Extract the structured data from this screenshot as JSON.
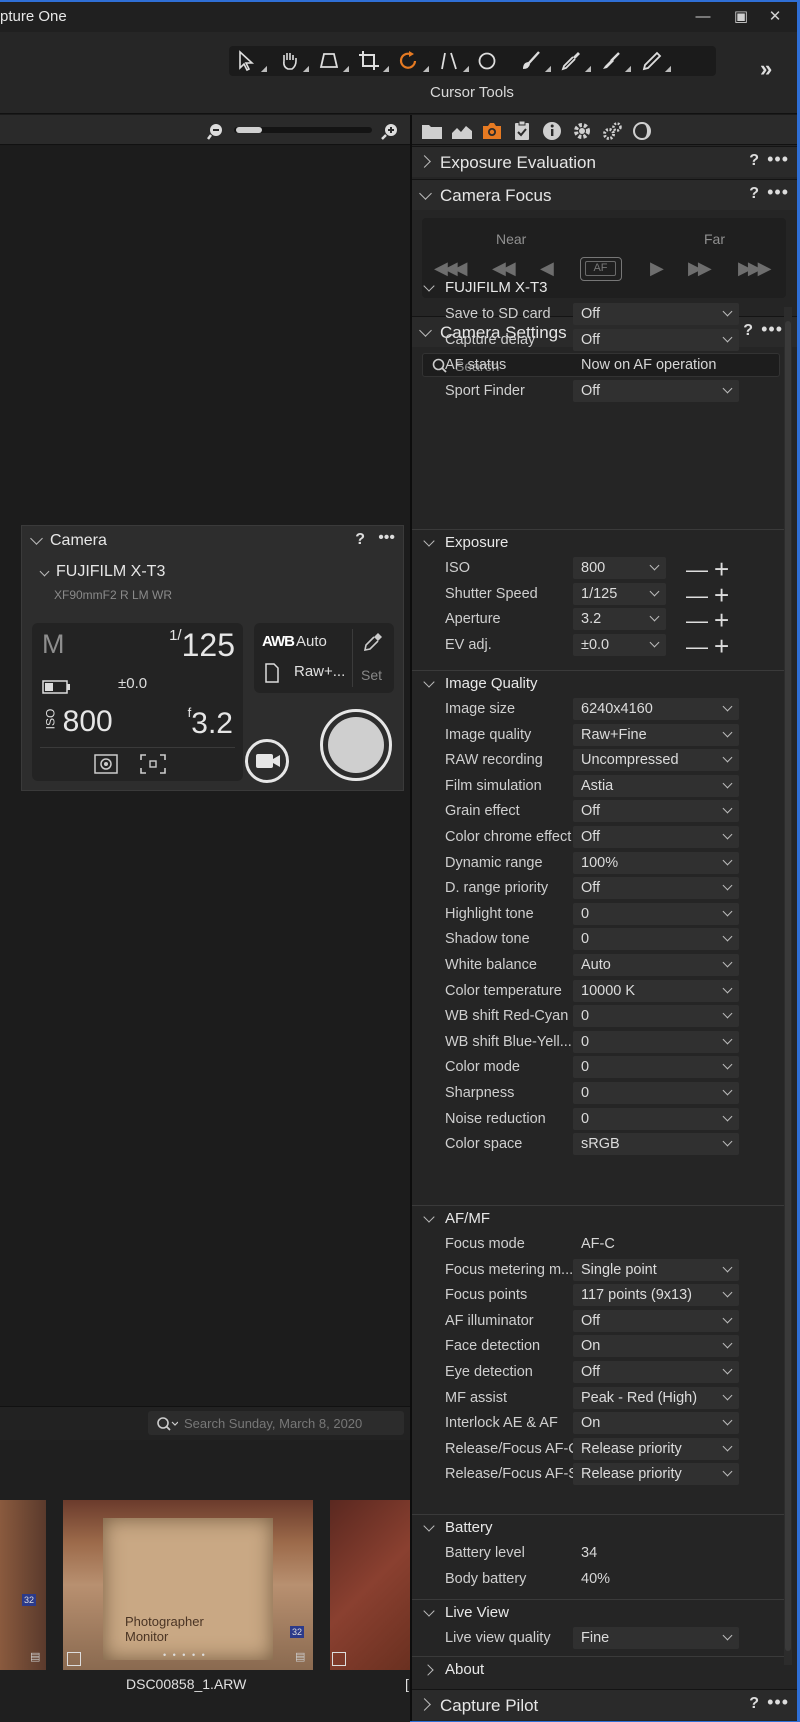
{
  "app": {
    "title": "pture One"
  },
  "toolbar": {
    "label": "Cursor Tools",
    "more": "»"
  },
  "viewer": {},
  "camera_panel": {
    "title": "Camera",
    "model": "FUJIFILM X-T3",
    "lens": "XF90mmF2 R LM WR",
    "mode": "M",
    "shutter_num": "1/",
    "shutter_den": "125",
    "ev": "±0.0",
    "iso_prefix": "ISO",
    "iso": "800",
    "f_prefix": "f",
    "aperture": "3.2",
    "wb_label": "AWB",
    "wb_value": "Auto",
    "format": "Raw+...",
    "set_label": "Set"
  },
  "browser": {
    "search_placeholder": "Search Sunday, March 8, 2020",
    "thumb_text": "Photographer Monitor",
    "thumb_badge": "32",
    "file_label": "DSC00858_1.ARW",
    "next_label": "[",
    "dots": "• • • • •"
  },
  "right_panel": {
    "exposure_eval": "Exposure Evaluation",
    "camera_focus": "Camera Focus",
    "near": "Near",
    "far": "Far",
    "af": "AF",
    "camera_settings": "Camera Settings",
    "search_placeholder": "Search",
    "help": "?",
    "more": "•••",
    "capture_pilot": "Capture Pilot",
    "groups": {
      "fuji": "FUJIFILM X-T3",
      "exposure": "Exposure",
      "image_quality": "Image Quality",
      "afmf": "AF/MF",
      "battery": "Battery",
      "live_view": "Live View",
      "about": "About"
    },
    "fuji_rows": [
      {
        "label": "Save to SD card",
        "value": "Off"
      },
      {
        "label": "Capture delay",
        "value": "Off"
      },
      {
        "label": "AF status",
        "value": "Now on AF operation"
      },
      {
        "label": "Sport Finder",
        "value": "Off"
      }
    ],
    "exposure_rows": [
      {
        "label": "ISO",
        "value": "800"
      },
      {
        "label": "Shutter Speed",
        "value": "1/125"
      },
      {
        "label": "Aperture",
        "value": "3.2"
      },
      {
        "label": "EV adj.",
        "value": "±0.0"
      }
    ],
    "iq_rows": [
      {
        "label": "Image size",
        "value": "6240x4160"
      },
      {
        "label": "Image quality",
        "value": "Raw+Fine"
      },
      {
        "label": "RAW recording",
        "value": "Uncompressed"
      },
      {
        "label": "Film simulation",
        "value": "Astia"
      },
      {
        "label": "Grain effect",
        "value": "Off"
      },
      {
        "label": "Color chrome effect",
        "value": "Off"
      },
      {
        "label": "Dynamic range",
        "value": "100%"
      },
      {
        "label": "D. range priority",
        "value": "Off"
      },
      {
        "label": "Highlight tone",
        "value": "0"
      },
      {
        "label": "Shadow tone",
        "value": "0"
      },
      {
        "label": "White balance",
        "value": "Auto"
      },
      {
        "label": "Color temperature",
        "value": "10000 K"
      },
      {
        "label": "WB shift Red-Cyan",
        "value": "0"
      },
      {
        "label": "WB shift Blue-Yell...",
        "value": "0"
      },
      {
        "label": "Color mode",
        "value": "0"
      },
      {
        "label": "Sharpness",
        "value": "0"
      },
      {
        "label": "Noise reduction",
        "value": "0"
      },
      {
        "label": "Color space",
        "value": "sRGB"
      }
    ],
    "af_rows": [
      {
        "label": "Focus mode",
        "value": "AF-C"
      },
      {
        "label": "Focus metering m...",
        "value": "Single point"
      },
      {
        "label": "Focus points",
        "value": "117 points (9x13)"
      },
      {
        "label": "AF illuminator",
        "value": "Off"
      },
      {
        "label": "Face detection",
        "value": "On"
      },
      {
        "label": "Eye detection",
        "value": "Off"
      },
      {
        "label": "MF assist",
        "value": "Peak - Red (High)"
      },
      {
        "label": "Interlock AE & AF",
        "value": "On"
      },
      {
        "label": "Release/Focus AF-C",
        "value": "Release priority"
      },
      {
        "label": "Release/Focus AF-S",
        "value": "Release priority"
      }
    ],
    "battery_rows": [
      {
        "label": "Battery level",
        "value": "34"
      },
      {
        "label": "Body battery",
        "value": "40%"
      }
    ],
    "live_rows": [
      {
        "label": "Live view quality",
        "value": "Fine"
      }
    ]
  },
  "colors": {
    "accent": "#e67a22",
    "frame": "#2f6fd6"
  }
}
